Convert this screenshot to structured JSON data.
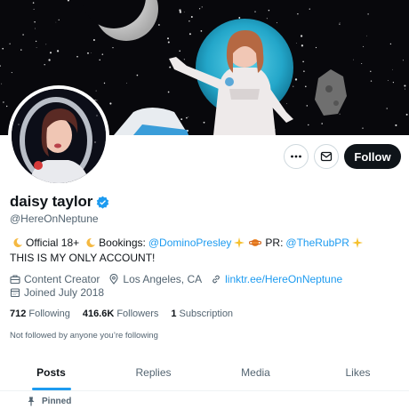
{
  "profile": {
    "display_name": "daisy taylor",
    "handle": "@HereOnNeptune",
    "verified_icon": "verified-badge-icon"
  },
  "actions": {
    "more_icon": "more-icon",
    "message_icon": "envelope-icon",
    "follow_label": "Follow"
  },
  "bio": {
    "part1": "Official 18+",
    "part2": "Bookings:",
    "bookings_link": "@DominoPresley",
    "part3": "PR:",
    "pr_link": "@TheRubPR",
    "line2": "THIS IS MY ONLY ACCOUNT!"
  },
  "meta": {
    "category": "Content Creator",
    "location": "Los Angeles, CA",
    "website": "linktr.ee/HereOnNeptune",
    "joined": "Joined July 2018"
  },
  "stats": {
    "following_count": "712",
    "following_label": "Following",
    "followers_count": "416.6K",
    "followers_label": "Followers",
    "subscription_count": "1",
    "subscription_label": "Subscription"
  },
  "followed_note": "Not followed by anyone you’re following",
  "tabs": [
    {
      "label": "Posts",
      "active": true
    },
    {
      "label": "Replies",
      "active": false
    },
    {
      "label": "Media",
      "active": false
    },
    {
      "label": "Likes",
      "active": false
    }
  ],
  "pinned_label": "Pinned",
  "colors": {
    "accent": "#1d9bf0",
    "text_primary": "#0f1419",
    "text_secondary": "#536471",
    "follow_bg": "#0f1419"
  }
}
